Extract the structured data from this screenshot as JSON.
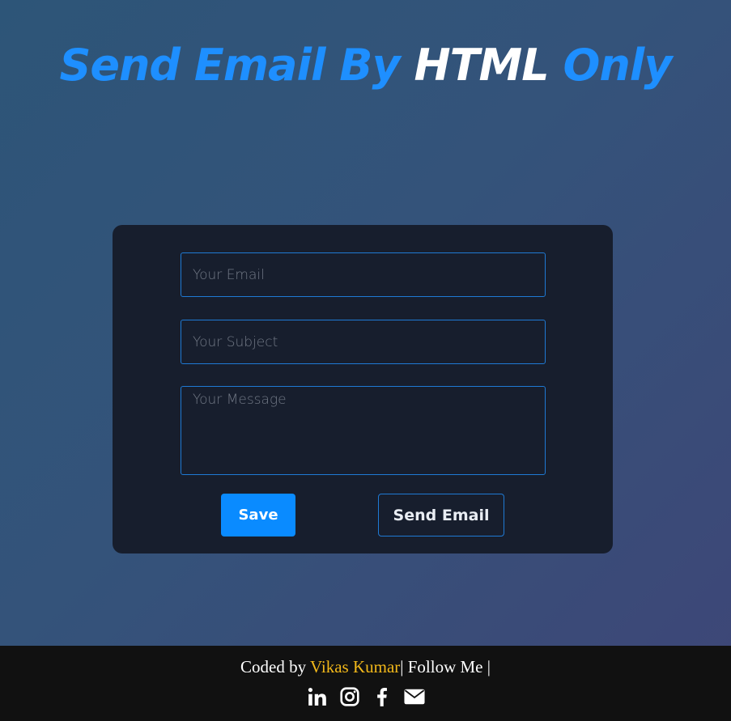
{
  "title": {
    "part1": "Send Email By ",
    "highlight": "HTML",
    "part2": " Only"
  },
  "form": {
    "email_placeholder": "Your Email",
    "subject_placeholder": "Your Subject",
    "message_placeholder": "Your Message",
    "save_label": "Save",
    "send_label": "Send Email"
  },
  "footer": {
    "coded_by": "Coded by ",
    "author": "Vikas Kumar",
    "follow": "| Follow Me |",
    "icons": [
      "linkedin-icon",
      "instagram-icon",
      "facebook-icon",
      "envelope-icon"
    ]
  },
  "colors": {
    "accent": "#1e8fff",
    "button": "#0a8bff",
    "author": "#f2b81a",
    "card": "#171e2d",
    "footer": "#111111"
  }
}
